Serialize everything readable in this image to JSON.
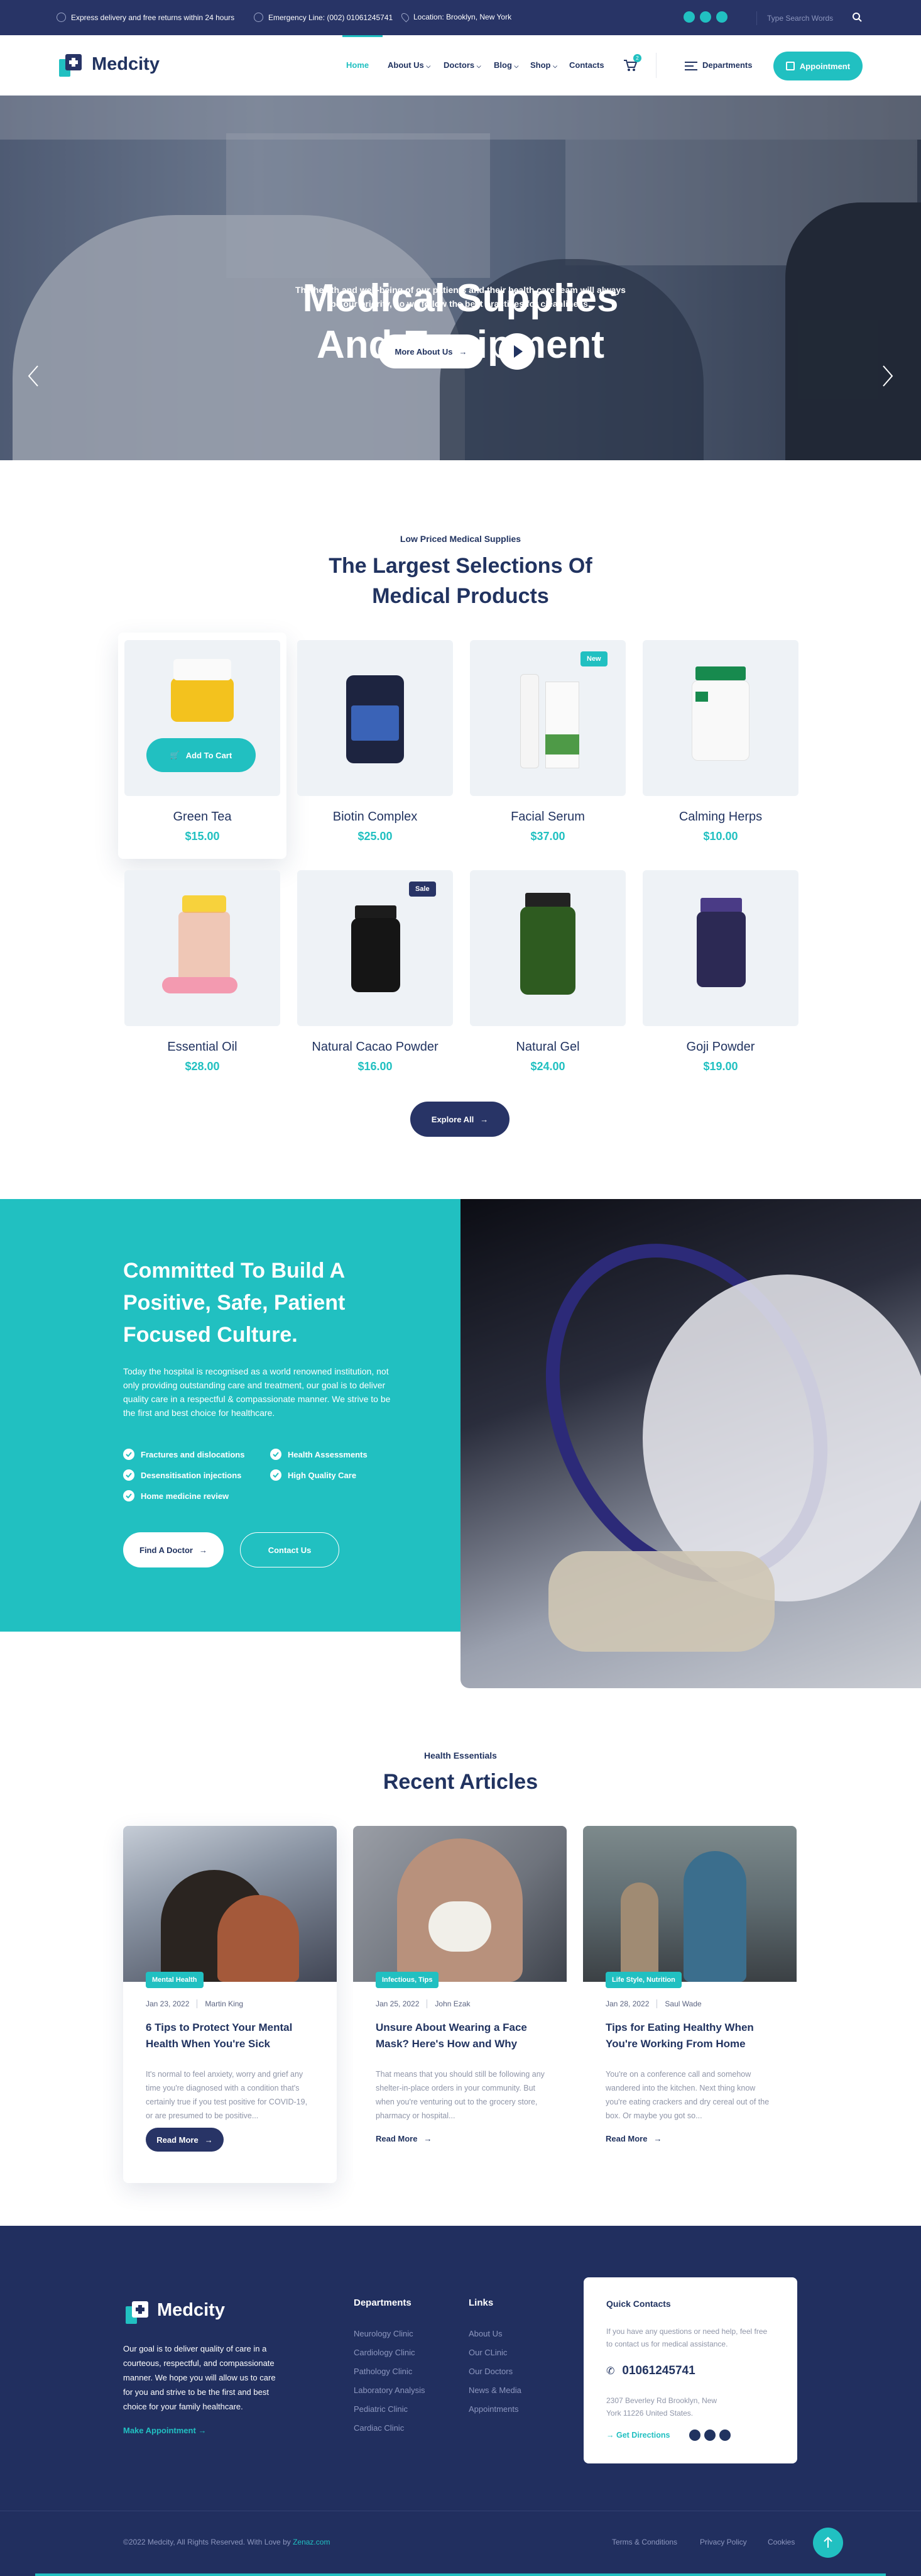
{
  "topbar": {
    "delivery": "Express delivery and free returns within 24 hours",
    "emergency": "Emergency Line: (002) 01061245741",
    "location": "Location: Brooklyn, New York",
    "search_placeholder": "Type Search Words"
  },
  "nav": {
    "brand": "Medcity",
    "items": [
      "Home",
      "About Us",
      "Doctors",
      "Blog",
      "Shop",
      "Contacts"
    ],
    "cart_count": "2",
    "departments": "Departments",
    "appointment": "Appointment"
  },
  "hero": {
    "title_line1": "Medical Supplies",
    "title_line2": "And Equipment",
    "subtitle": "The health and well-being of our patients and their health care team will always be our priority, so we follow the best practices for cleanliness.",
    "cta": "More About Us"
  },
  "products_section": {
    "pretitle": "Low Priced Medical Supplies",
    "title_line1": "The Largest Selections Of",
    "title_line2": "Medical Products",
    "add_to_cart": "Add To Cart",
    "explore": "Explore All",
    "items": [
      {
        "name": "Green Tea",
        "price": "$15.00"
      },
      {
        "name": "Biotin Complex",
        "price": "$25.00"
      },
      {
        "name": "Facial Serum",
        "price": "$37.00",
        "tag": "New"
      },
      {
        "name": "Calming Herps",
        "price": "$10.00"
      },
      {
        "name": "Essential Oil",
        "price": "$28.00"
      },
      {
        "name": "Natural Cacao Powder",
        "price": "$16.00",
        "tag": "Sale"
      },
      {
        "name": "Natural Gel",
        "price": "$24.00"
      },
      {
        "name": "Goji Powder",
        "price": "$19.00"
      }
    ]
  },
  "culture": {
    "title_line1": "Committed To Build A",
    "title_line2": "Positive, Safe, Patient",
    "title_line3": "Focused Culture.",
    "text": "Today the hospital is recognised as a world renowned institution, not only providing outstanding care and treatment, our goal is to deliver quality care in a respectful & compassionate manner. We strive to be the first and best choice for healthcare.",
    "checks": [
      "Fractures and dislocations",
      "Health Assessments",
      "Desensitisation injections",
      "High Quality Care",
      "Home medicine review"
    ],
    "find_doctor": "Find A Doctor",
    "contact": "Contact Us"
  },
  "articles_section": {
    "pretitle": "Health Essentials",
    "title": "Recent Articles",
    "read_more": "Read More",
    "items": [
      {
        "tag": "Mental Health",
        "date": "Jan 23, 2022",
        "author": "Martin King",
        "title": "6 Tips to Protect Your Mental Health When You're Sick",
        "excerpt": "It's normal to feel anxiety, worry and grief any time you're diagnosed with a condition that's certainly true if you test positive for COVID-19, or are presumed to be positive..."
      },
      {
        "tag": "Infectious, Tips",
        "date": "Jan 25, 2022",
        "author": "John Ezak",
        "title": "Unsure About Wearing a Face Mask? Here's How and Why",
        "excerpt": "That means that you should still be following any shelter-in-place orders in your community. But when you're venturing out to the grocery store, pharmacy or hospital..."
      },
      {
        "tag": "Life Style, Nutrition",
        "date": "Jan 28, 2022",
        "author": "Saul Wade",
        "title": "Tips for Eating Healthy When You're Working From Home",
        "excerpt": "You're on a conference call and somehow wandered into the kitchen. Next thing know you're eating crackers and dry cereal out of the box. Or maybe you got so..."
      }
    ]
  },
  "footer": {
    "brand": "Medcity",
    "about": "Our goal is to deliver quality of care in a courteous, respectful, and compassionate manner. We hope you will allow us to care for you and strive to be the first and best choice for your family healthcare.",
    "make_appointment": "Make Appointment",
    "departments_title": "Departments",
    "departments": [
      "Neurology Clinic",
      "Cardiology Clinic",
      "Pathology Clinic",
      "Laboratory Analysis",
      "Pediatric Clinic",
      "Cardiac Clinic"
    ],
    "links_title": "Links",
    "links": [
      "About Us",
      "Our CLinic",
      "Our Doctors",
      "News & Media",
      "Appointments"
    ],
    "quick_title": "Quick Contacts",
    "quick_text": "If you have any questions or need help, feel free to contact us for medical assistance.",
    "phone": "01061245741",
    "address": "2307 Beverley Rd Brooklyn, New York 11226 United States.",
    "directions": "Get Directions",
    "copyright": "©2022 Medcity, All Rights Reserved. With Love by ",
    "copyright_link": "Zenaz.com",
    "bottom_links": [
      "Terms & Conditions",
      "Privacy Policy",
      "Cookies"
    ]
  }
}
